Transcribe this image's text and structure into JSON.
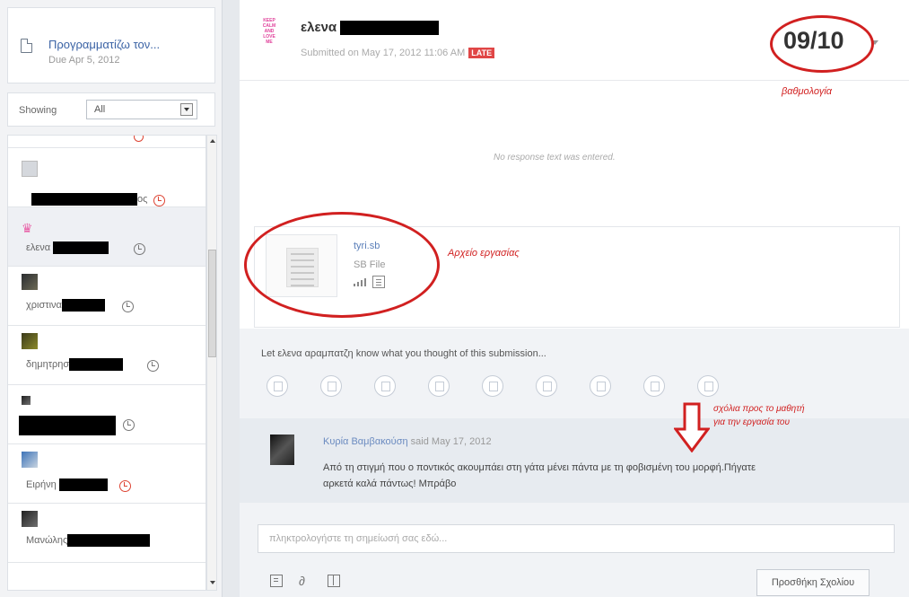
{
  "assignment": {
    "title": "Προγραμματίζω τον...",
    "due": "Due Apr 5, 2012"
  },
  "filter": {
    "showing_label": "Showing",
    "selected": "All",
    "options": [
      "All"
    ]
  },
  "students": [
    {
      "name": "ος",
      "late": true
    },
    {
      "name": "ελενα",
      "late": false,
      "selected": true
    },
    {
      "name": "χριστινα",
      "late": false
    },
    {
      "name": "δημητρησ",
      "late": false
    },
    {
      "name": "",
      "late": false
    },
    {
      "name": "Ειρήνη",
      "late": true
    },
    {
      "name": "Μανώλης",
      "late": false
    }
  ],
  "submission": {
    "student_name": "ελενα",
    "meta": "Submitted on May 17, 2012 11:06 AM",
    "late_badge": "LATE",
    "grade": "09/10",
    "no_response": "No response text was entered.",
    "avatar_text": "KEEP CALM AND LOVE ME"
  },
  "file": {
    "name": "tyri.sb",
    "type": "SB File"
  },
  "annotations": {
    "grade": "βαθμολογία",
    "file": "Αρχείο εργασίας",
    "comment_line1": "σχόλια προς το μαθητή",
    "comment_line2": "για την εργασία του"
  },
  "feedback": {
    "prompt": "Let ελενα αραμπατζη know what you thought of this submission...",
    "emoji_count": 9
  },
  "comment": {
    "author": "Κυρία Βαμβακούση",
    "said": "said May 17, 2012",
    "text": "Από τη στιγμή που ο ποντικός ακουμπάει στη γάτα μένει πάντα με τη φοβισμένη του μορφή.Πήγατε αρκετά καλά πάντως! Μπράβο"
  },
  "comment_input": {
    "placeholder": "πληκτρολογήστε τη σημείωσή σας εδώ...",
    "value": ""
  },
  "buttons": {
    "add_comment": "Προσθήκη Σχολίου"
  },
  "colors": {
    "link": "#3b63a5",
    "late": "#e04646",
    "annotation": "#d12020"
  }
}
